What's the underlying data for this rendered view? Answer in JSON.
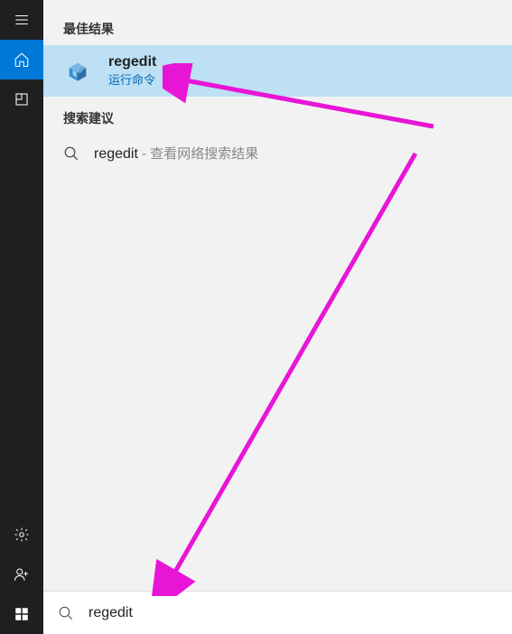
{
  "rail": {
    "items": [
      {
        "name": "hamburger-icon"
      },
      {
        "name": "home-icon"
      },
      {
        "name": "apps-icon"
      }
    ],
    "bottom": [
      {
        "name": "settings-icon"
      },
      {
        "name": "account-icon"
      },
      {
        "name": "start-icon"
      }
    ]
  },
  "sections": {
    "best_header": "最佳结果",
    "suggest_header": "搜索建议"
  },
  "best_result": {
    "title": "regedit",
    "sub": "运行命令",
    "icon": "regedit-cube-icon"
  },
  "suggestion": {
    "main": "regedit",
    "desc": "查看网络搜索结果"
  },
  "search": {
    "value": "regedit",
    "placeholder": ""
  }
}
